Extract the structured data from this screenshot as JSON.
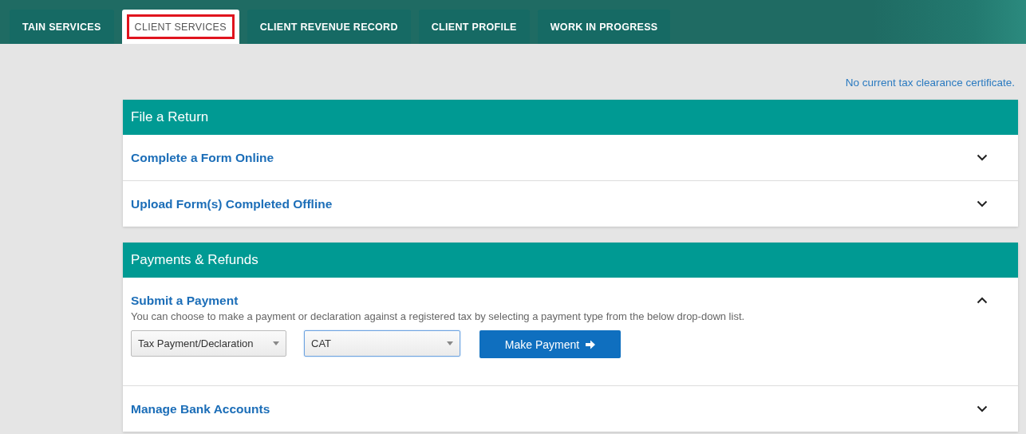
{
  "tabs": [
    {
      "label": "TAIN SERVICES",
      "selected": false,
      "highlighted": false
    },
    {
      "label": "CLIENT SERVICES",
      "selected": true,
      "highlighted": true
    },
    {
      "label": "CLIENT REVENUE RECORD",
      "selected": false,
      "highlighted": false
    },
    {
      "label": "CLIENT PROFILE",
      "selected": false,
      "highlighted": false
    },
    {
      "label": "WORK IN PROGRESS",
      "selected": false,
      "highlighted": false
    }
  ],
  "notice": "No current tax clearance certificate.",
  "sections": [
    {
      "title": "File a Return",
      "items": [
        {
          "title": "Complete a Form Online",
          "expanded": false
        },
        {
          "title": "Upload Form(s) Completed Offline",
          "expanded": false
        }
      ]
    },
    {
      "title": "Payments & Refunds",
      "items": [
        {
          "title": "Submit a Payment",
          "expanded": true,
          "description": "You can choose to make a payment or declaration against a registered tax by selecting a payment type from the below drop-down list.",
          "selects": [
            {
              "value": "Tax Payment/Declaration",
              "focused": false
            },
            {
              "value": "CAT",
              "focused": true
            }
          ],
          "button": "Make Payment"
        },
        {
          "title": "Manage Bank Accounts",
          "expanded": false
        }
      ]
    }
  ]
}
